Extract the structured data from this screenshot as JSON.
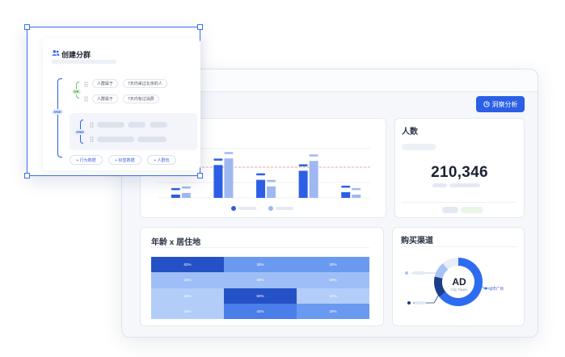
{
  "dashboard": {
    "insight_button": "洞察分析",
    "people_card": {
      "title": "人数",
      "value": "210,346"
    },
    "heatmap_card": {
      "title": "年龄 x 居住地",
      "cells": [
        [
          "52%",
          "35%",
          "30%"
        ],
        [
          "22%",
          "25%",
          "30%"
        ],
        [
          "15%",
          "50%",
          "12%"
        ],
        [
          "15%",
          "42%",
          "30%"
        ]
      ],
      "cell_colors": [
        [
          "#2452c6",
          "#6a9af0",
          "#6a9af0"
        ],
        [
          "#9ebef7",
          "#9ebef7",
          "#9ebef7"
        ],
        [
          "#b3cdf9",
          "#2452c6",
          "#b3cdf9"
        ],
        [
          "#b3cdf9",
          "#4a7ee8",
          "#6a9af0"
        ]
      ]
    },
    "donut_card": {
      "title": "购买渠道",
      "center_main": "AD",
      "center_sub": "City Tower",
      "right_label": "城市广场"
    },
    "bar_chart": {
      "values_a": [
        4,
        40,
        22,
        33,
        7
      ],
      "values_b": [
        6,
        48,
        14,
        45,
        4
      ],
      "colors": {
        "a": "#2d5ee6",
        "b": "#9fb8f2",
        "line": "#f08a8a"
      }
    }
  },
  "builder": {
    "title": "创建分群",
    "icon": "users-icon",
    "or_label": "OR",
    "and_label": "AND",
    "inner_and_label": "AND",
    "row1": {
      "tag1": "人群属于",
      "tag2": "7天内来过北京的人"
    },
    "row2": {
      "tag1": "人群属于",
      "tag2": "7天内有过消费"
    },
    "add_buttons": [
      "+ 行为数据",
      "+ 标签数据",
      "+ 人群包"
    ],
    "colors": {
      "accent": "#2d5ee6",
      "or_bg": "#e5f6e3",
      "or_fg": "#3a9b3a",
      "and_bg": "#e8eefc",
      "and_fg": "#2d5ee6"
    }
  }
}
